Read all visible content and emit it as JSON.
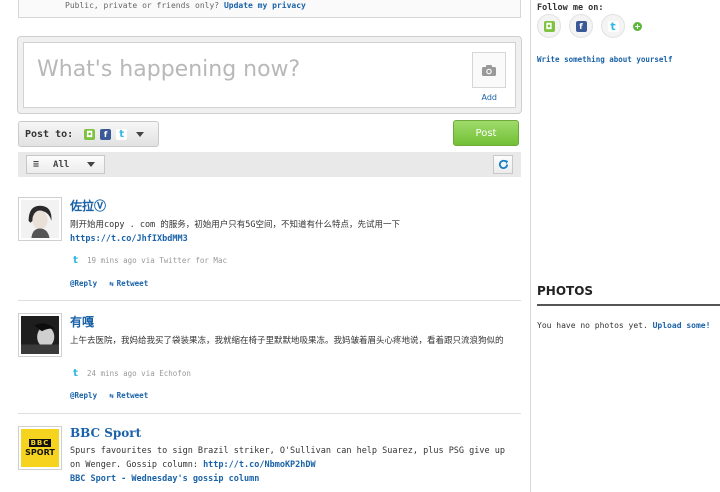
{
  "privacy_bar": {
    "text": "Public, private or friends only?",
    "link": "Update my privacy"
  },
  "composer": {
    "placeholder": "What's happening now?",
    "add_label": "Add"
  },
  "post_to": {
    "label": "Post to:",
    "networks": [
      "myspace-icon",
      "facebook-icon",
      "twitter-icon"
    ]
  },
  "post_button": "Post",
  "filter": {
    "selected": "All"
  },
  "feed": [
    {
      "author": "佐拉Ⓥ",
      "text": "刚开始用copy . com 的服务，初始用户只有5G空间，不知道有什么特点，先试用一下",
      "link": "https://t.co/JhfIXbdMM3",
      "time": "19 mins ago via Twitter for Mac",
      "reply": "@Reply",
      "retweet": "Retweet"
    },
    {
      "author": "有嘎",
      "text": "上午去医院，我妈给我买了袋装果冻，我就缩在椅子里默默地吸果冻。我妈皱着眉头心疼地说，看着跟只流浪狗似的",
      "time": "24 mins ago via Echofon",
      "reply": "@Reply",
      "retweet": "Retweet"
    },
    {
      "author": "BBC Sport",
      "text": "Spurs favourites to sign Brazil striker, O'Sullivan can help Suarez, plus PSG give up on Wenger. Gossip column:",
      "link": "http://t.co/NbmoKP2hDW",
      "extra_link": "BBC Sport - Wednesday's gossip column",
      "avatar_text_1": "BBC",
      "avatar_text_2": "SPORT"
    }
  ],
  "sidebar": {
    "follow_title": "Follow me on:",
    "about_link": "Write something about yourself",
    "photos_title": "PHOTOS",
    "photos_text": "You have no photos yet.",
    "photos_link": "Upload some!"
  },
  "colors": {
    "link": "#1a62a8",
    "post_green": "#72c036",
    "twitter_blue": "#33b7e6",
    "facebook_blue": "#3b5998",
    "bbc_yellow": "#f6d31f"
  }
}
